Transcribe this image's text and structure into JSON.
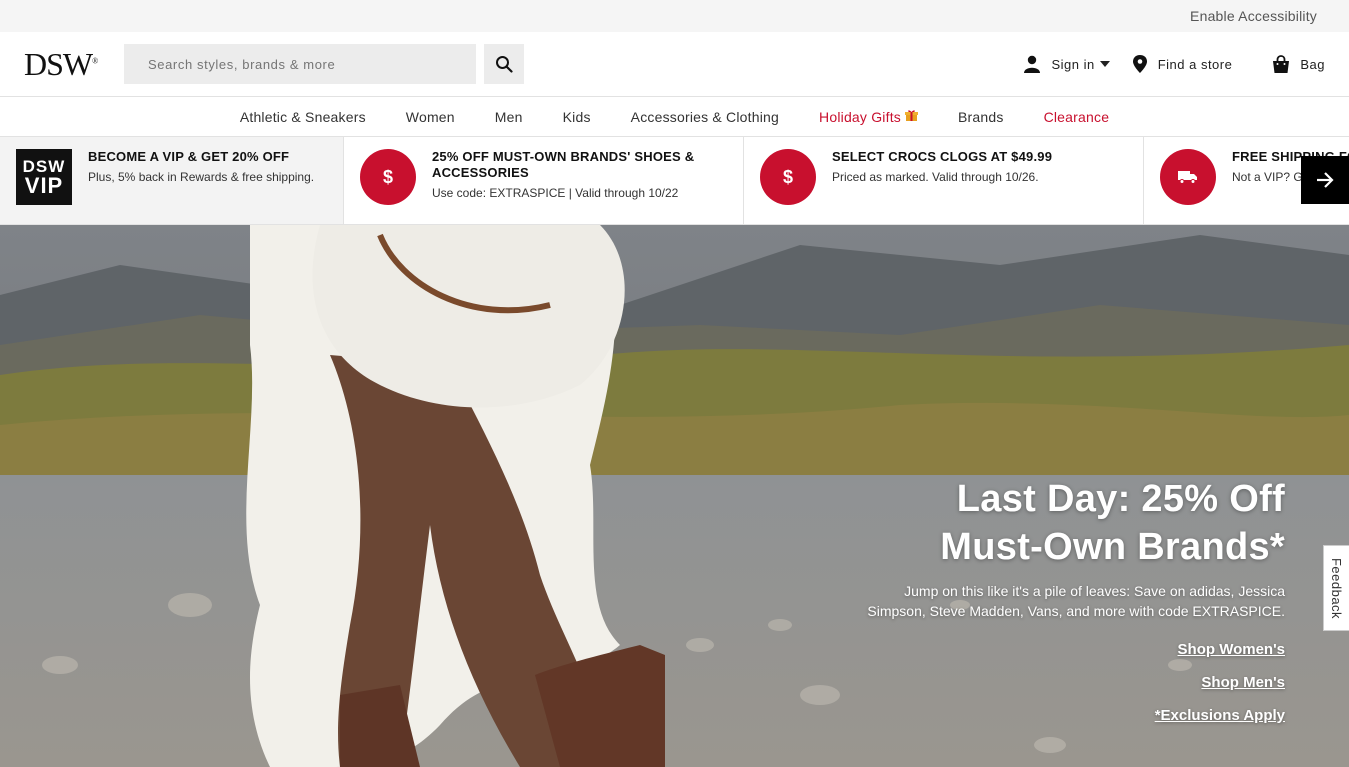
{
  "utility": {
    "accessibility_link": "Enable Accessibility"
  },
  "header": {
    "logo": "DSW",
    "search_placeholder": "Search styles, brands & more",
    "sign_in": "Sign in",
    "find_store": "Find a store",
    "bag": "Bag"
  },
  "nav": {
    "items": [
      "Athletic & Sneakers",
      "Women",
      "Men",
      "Kids",
      "Accessories & Clothing",
      "Holiday Gifts",
      "Brands",
      "Clearance"
    ],
    "highlight_color": "#c8102e"
  },
  "promos": [
    {
      "badge_line1": "DSW",
      "badge_line2": "VIP",
      "title": "BECOME A VIP & GET 20% OFF",
      "subtitle": "Plus, 5% back in Rewards & free shipping."
    },
    {
      "icon": "$",
      "title": "25% OFF MUST-OWN BRANDS' SHOES & ACCESSORIES",
      "subtitle": "Use code: EXTRASPICE | Valid through 10/22"
    },
    {
      "icon": "$",
      "title": "SELECT CROCS CLOGS AT $49.99",
      "subtitle": "Priced as marked. Valid through 10/26."
    },
    {
      "icon": "truck-icon",
      "title": "FREE SHIPPING FO",
      "subtitle": "Not a VIP? Ge"
    }
  ],
  "hero": {
    "title_line1": "Last Day: 25% Off",
    "title_line2": "Must-Own Brands*",
    "subtitle": "Jump on this like it's a pile of leaves: Save on adidas, Jessica Simpson, Steve Madden, Vans, and more with code EXTRASPICE.",
    "link_women": "Shop Women's",
    "link_men": "Shop Men's",
    "link_exclusions": "*Exclusions Apply"
  },
  "feedback_tab": "Feedback",
  "colors": {
    "brand_red": "#c8102e",
    "dark": "#111111"
  }
}
